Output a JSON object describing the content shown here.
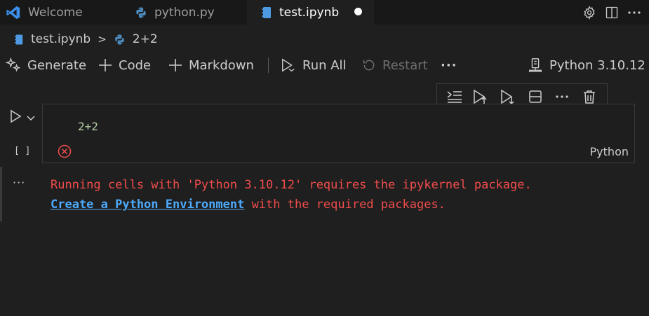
{
  "tabs": [
    {
      "label": "Welcome",
      "icon": "vscode-logo-icon",
      "active": false
    },
    {
      "label": "python.py",
      "icon": "python-icon",
      "active": false
    },
    {
      "label": "test.ipynb",
      "icon": "notebook-icon",
      "active": true,
      "dirty": true
    }
  ],
  "tab_actions": [
    "gear-icon",
    "split-editor-icon",
    "more-icon"
  ],
  "breadcrumb": {
    "file": "test.ipynb",
    "separator": ">",
    "symbol": "2+2"
  },
  "toolbar": {
    "generate": "Generate",
    "code": "Code",
    "markdown": "Markdown",
    "run_all": "Run All",
    "restart": "Restart",
    "more": "···",
    "kernel": "Python 3.10.12"
  },
  "cell": {
    "execution_count": "[ ]",
    "source": "2+2",
    "language": "Python",
    "status": "failed",
    "toolbar_icons": [
      "execute-above-icon",
      "run-above-icon",
      "run-below-icon",
      "split-cell-icon",
      "more-icon",
      "delete-icon"
    ]
  },
  "output": {
    "more": "···",
    "line1": "Running cells with 'Python 3.10.12' requires the ipykernel package.",
    "link": "Create a Python Environment",
    "line2_rest": " with the required packages."
  },
  "colors": {
    "background": "#1f1f1f",
    "error_text": "#f14c4c",
    "link": "#4daafc",
    "number": "#b5cea8",
    "vscode_blue": "#3b8eea"
  }
}
